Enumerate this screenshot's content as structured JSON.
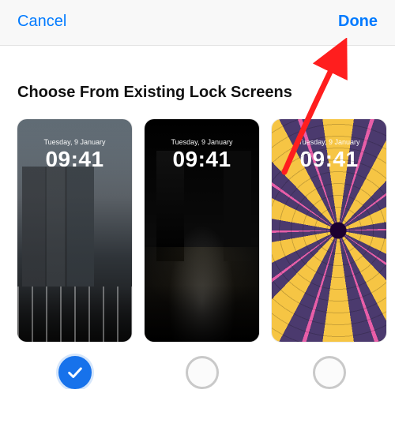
{
  "nav": {
    "cancel": "Cancel",
    "done": "Done"
  },
  "section_title": "Choose From Existing Lock Screens",
  "lock_screen_overlay": {
    "date": "Tuesday, 9 January",
    "time": "09:41"
  },
  "options": [
    {
      "wallpaper": "city-day",
      "selected": true
    },
    {
      "wallpaper": "dark-street",
      "selected": false
    },
    {
      "wallpaper": "emoji-spiral",
      "selected": false
    }
  ],
  "colors": {
    "accent": "#007aff",
    "selected_radio": "#1772eb",
    "annotation_arrow": "#ff1e1e"
  },
  "annotation": {
    "arrow_points_to": "done-button"
  }
}
